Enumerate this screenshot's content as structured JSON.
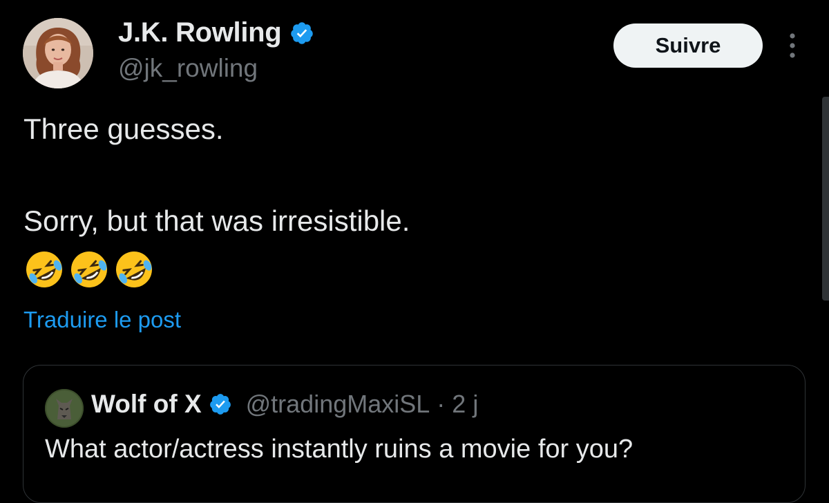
{
  "author": {
    "name": "J.K. Rowling",
    "handle": "@jk_rowling",
    "avatar_icon": "avatar-photo",
    "verified_icon": "verified-badge-icon"
  },
  "actions": {
    "follow_label": "Suivre",
    "more_icon": "more-vertical-icon"
  },
  "post": {
    "lines": [
      "Three guesses.",
      "Sorry, but that was irresistible."
    ],
    "emojis": [
      "🤣",
      "🤣",
      "🤣"
    ],
    "translate_label": "Traduire le post"
  },
  "quoted_post": {
    "name": "Wolf of X",
    "handle": "@tradingMaxiSL",
    "separator": "·",
    "time": "2 j",
    "text": "What actor/actress instantly ruins a movie for you?"
  },
  "colors": {
    "background": "#000000",
    "text_primary": "#e7e9ea",
    "text_secondary": "#71767b",
    "link": "#1d9bf0",
    "verified": "#1d9bf0",
    "border": "#2f3336",
    "follow_bg": "#eff3f4"
  }
}
